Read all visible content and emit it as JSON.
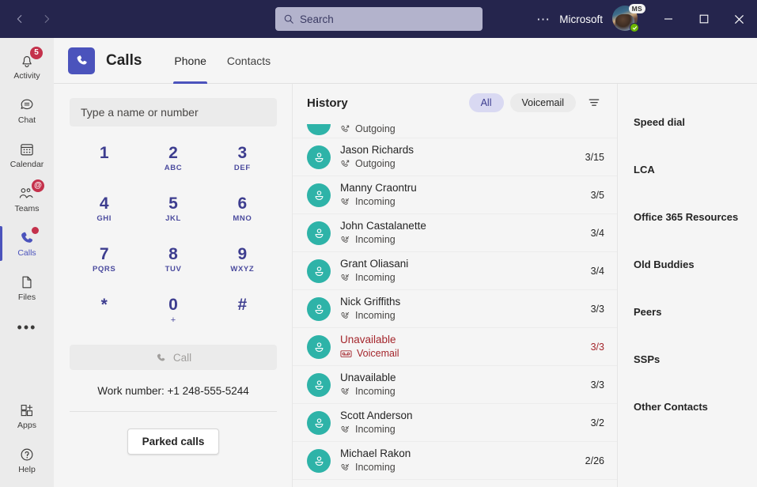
{
  "titlebar": {
    "back_icon": "chevron-left-icon",
    "forward_icon": "chevron-right-icon",
    "search_placeholder": "Search",
    "search_icon": "search-icon",
    "more_label": "⋯",
    "org_name": "Microsoft",
    "avatar_badge": "MS",
    "presence": "available",
    "minimize_label": "—",
    "maximize_label": "□",
    "close_label": "✕"
  },
  "rail": {
    "items": [
      {
        "label": "Activity",
        "icon": "bell-icon",
        "badge": "5",
        "badge_type": "count",
        "active": false
      },
      {
        "label": "Chat",
        "icon": "chat-icon",
        "badge": "",
        "badge_type": "none",
        "active": false
      },
      {
        "label": "Calendar",
        "icon": "calendar-icon",
        "badge": "",
        "badge_type": "none",
        "active": false
      },
      {
        "label": "Teams",
        "icon": "teams-icon",
        "badge": "@",
        "badge_type": "mention",
        "active": false
      },
      {
        "label": "Calls",
        "icon": "phone-icon",
        "badge": "",
        "badge_type": "dot",
        "active": true
      },
      {
        "label": "Files",
        "icon": "file-icon",
        "badge": "",
        "badge_type": "none",
        "active": false
      }
    ],
    "more_label": "•••",
    "apps_label": "Apps",
    "help_label": "Help"
  },
  "header": {
    "app_icon": "phone-icon",
    "title": "Calls",
    "tabs": [
      {
        "label": "Phone",
        "active": true
      },
      {
        "label": "Contacts",
        "active": false
      }
    ]
  },
  "dialpad": {
    "input_placeholder": "Type a name or number",
    "keys": [
      {
        "digit": "1",
        "letters": ""
      },
      {
        "digit": "2",
        "letters": "ABC"
      },
      {
        "digit": "3",
        "letters": "DEF"
      },
      {
        "digit": "4",
        "letters": "GHI"
      },
      {
        "digit": "5",
        "letters": "JKL"
      },
      {
        "digit": "6",
        "letters": "MNO"
      },
      {
        "digit": "7",
        "letters": "PQRS"
      },
      {
        "digit": "8",
        "letters": "TUV"
      },
      {
        "digit": "9",
        "letters": "WXYZ"
      },
      {
        "digit": "*",
        "letters": ""
      },
      {
        "digit": "0",
        "letters": "+"
      },
      {
        "digit": "#",
        "letters": ""
      }
    ],
    "call_label": "Call",
    "call_icon": "phone-icon",
    "work_number": "Work number: +1 248-555-5244",
    "parked_calls_label": "Parked calls"
  },
  "history": {
    "title": "History",
    "filters": [
      {
        "label": "All",
        "selected": true
      },
      {
        "label": "Voicemail",
        "selected": false
      }
    ],
    "filter_icon": "filter-icon",
    "rows": [
      {
        "name": "",
        "type": "Outgoing",
        "type_icon": "call-outgoing-icon",
        "date": "",
        "clipped": true,
        "voicemail": false
      },
      {
        "name": "Jason Richards",
        "type": "Outgoing",
        "type_icon": "call-outgoing-icon",
        "date": "3/15",
        "clipped": false,
        "voicemail": false
      },
      {
        "name": "Manny Craontru",
        "type": "Incoming",
        "type_icon": "call-incoming-icon",
        "date": "3/5",
        "clipped": false,
        "voicemail": false
      },
      {
        "name": "John Castalanette",
        "type": "Incoming",
        "type_icon": "call-incoming-icon",
        "date": "3/4",
        "clipped": false,
        "voicemail": false
      },
      {
        "name": "Grant Oliasani",
        "type": "Incoming",
        "type_icon": "call-incoming-icon",
        "date": "3/4",
        "clipped": false,
        "voicemail": false
      },
      {
        "name": "Nick Griffiths",
        "type": "Incoming",
        "type_icon": "call-incoming-icon",
        "date": "3/3",
        "clipped": false,
        "voicemail": false
      },
      {
        "name": "Unavailable",
        "type": "Voicemail",
        "type_icon": "voicemail-icon",
        "date": "3/3",
        "clipped": false,
        "voicemail": true
      },
      {
        "name": "Unavailable",
        "type": "Incoming",
        "type_icon": "call-incoming-icon",
        "date": "3/3",
        "clipped": false,
        "voicemail": false
      },
      {
        "name": "Scott Anderson",
        "type": "Incoming",
        "type_icon": "call-incoming-icon",
        "date": "3/2",
        "clipped": false,
        "voicemail": false
      },
      {
        "name": "Michael Rakon",
        "type": "Incoming",
        "type_icon": "call-incoming-icon",
        "date": "2/26",
        "clipped": false,
        "voicemail": false
      }
    ]
  },
  "contacts": {
    "groups": [
      {
        "label": "Speed dial"
      },
      {
        "label": "LCA"
      },
      {
        "label": "Office 365 Resources"
      },
      {
        "label": "Old Buddies"
      },
      {
        "label": "Peers"
      },
      {
        "label": "SSPs"
      },
      {
        "label": "Other Contacts"
      }
    ]
  },
  "colors": {
    "titlebar": "#25254d",
    "accent": "#4b53bc",
    "avatar_teal": "#2eb3a8",
    "badge_red": "#c4314b",
    "voicemail_red": "#a4262c",
    "presence_green": "#6bb700"
  }
}
